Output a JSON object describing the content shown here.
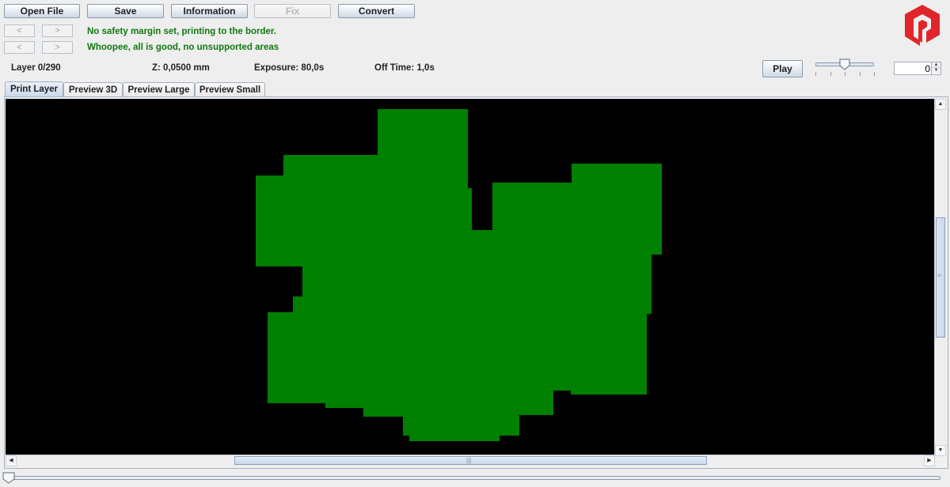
{
  "toolbar": {
    "buttons": [
      {
        "label": "Open File",
        "enabled": true
      },
      {
        "label": "Save",
        "enabled": true
      },
      {
        "label": "Information",
        "enabled": true
      },
      {
        "label": "Fix",
        "enabled": false
      },
      {
        "label": "Convert",
        "enabled": true
      }
    ]
  },
  "messages": {
    "safety": {
      "prev": "<",
      "next": ">",
      "text": "No safety margin set, printing to the border."
    },
    "support": {
      "prev": "<",
      "next": ">",
      "text": "Whoopee, all is good, no unsupported areas"
    }
  },
  "info": {
    "layer": "Layer 0/290",
    "z": "Z: 0,0500 mm",
    "exposure": "Exposure: 80,0s",
    "off_time": "Off Time: 1,0s"
  },
  "playback": {
    "play_label": "Play",
    "speed_slider_value": 0.5,
    "speed_slider_ticks": 5,
    "spinner_value": "0",
    "spinner_up": "▲",
    "spinner_down": "▼"
  },
  "tabs": [
    {
      "label": "Print Layer",
      "active": true
    },
    {
      "label": "Preview 3D",
      "active": false
    },
    {
      "label": "Preview Large",
      "active": false
    },
    {
      "label": "Preview Small",
      "active": false
    }
  ],
  "layer_view": {
    "background_color": "#000000",
    "layer_color": "#008000",
    "vertical_scroll_position": 0.46,
    "horizontal_scroll_position": 0.5
  },
  "layer_slider": {
    "value": 0,
    "max": 290
  },
  "scroll_icons": {
    "up": "▲",
    "down": "▼",
    "left": "◀",
    "right": "▶",
    "grip_v": "≡",
    "grip_h": "|||"
  },
  "brand": {
    "logo_color": "#e0262b"
  }
}
